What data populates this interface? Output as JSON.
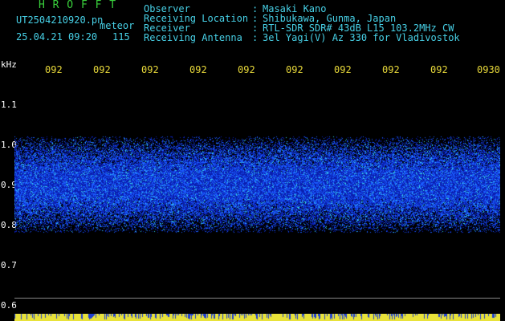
{
  "header": {
    "brand": "H R O F F T",
    "filename": "UT2504210920.pn",
    "meteor_label": "meteor",
    "datetime": "25.04.21 09:20",
    "count": "115",
    "fields": [
      {
        "label": "Observer",
        "value": "Masaki Kano"
      },
      {
        "label": "Receiving Location",
        "value": "Shibukawa, Gunma, Japan"
      },
      {
        "label": "Receiver",
        "value": "RTL-SDR SDR# 43dB L15 103.2MHz CW"
      },
      {
        "label": "Receiving Antenna",
        "value": "3el Yagi(V) Az 330 for Vladivostok"
      }
    ],
    "separator": ":"
  },
  "axes": {
    "y_unit": "kHz",
    "y_ticks": [
      "1.1",
      "1.0",
      "0.9",
      "0.8",
      "0.7",
      "0.6"
    ],
    "x_ticks": [
      "092",
      "092",
      "092",
      "092",
      "092",
      "092",
      "092",
      "092",
      "092",
      "0930"
    ]
  },
  "colors": {
    "background": "#000000",
    "noise_dark": "#0a1fb0",
    "noise_mid": "#1a5cff",
    "noise_bright": "#35d4e8",
    "baseline": "#e8e23a",
    "label_green": "#39d13c",
    "label_cyan": "#47d0e6"
  },
  "display": {
    "band_center_khz": 0.9,
    "band_low_khz": 0.78,
    "band_high_khz": 1.02
  }
}
